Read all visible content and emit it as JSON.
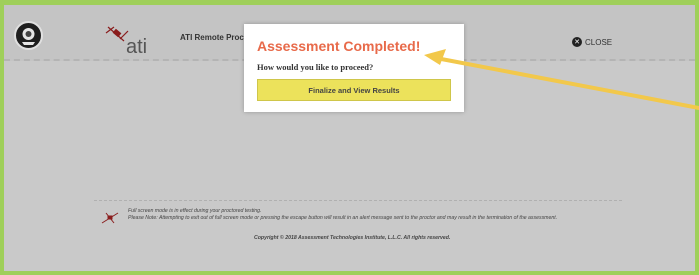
{
  "header": {
    "proctoring_title": "ATI Remote Proctoring",
    "close_label": "CLOSE",
    "logo_text": "ati"
  },
  "modal": {
    "title": "Assessment Completed!",
    "question": "How would you like to proceed?",
    "finalize_button": "Finalize and View Results"
  },
  "footer": {
    "fullscreen_note": "Full screen mode is in effect during your proctored testing.",
    "warning": "Please Note: Attempting to exit out of full screen mode or pressing the escape button will result in an alert message sent to the proctor and may result in the termination of the assessment.",
    "copyright": "Copyright © 2018 Assessment Technologies Institute, L.L.C. All rights reserved."
  },
  "colors": {
    "page_border": "#9fcf5a",
    "modal_title": "#e86a4a",
    "finalize_button": "#ece25b",
    "annotation_arrow": "#f2c84b"
  },
  "icons": [
    "webcam-icon",
    "ati-logo",
    "close-icon",
    "footer-satellite-icon",
    "annotation-arrow"
  ]
}
